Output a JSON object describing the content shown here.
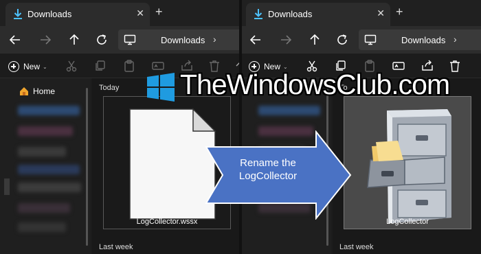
{
  "left_window": {
    "tab_title": "Downloads",
    "tab_close": "✕",
    "new_tab": "+",
    "address": "Downloads",
    "address_chevron": "›",
    "new_label": "New",
    "new_chevron": "⌄",
    "sidebar": {
      "home_label": "Home"
    },
    "group_today": "Today",
    "group_last_week": "Last week",
    "file": {
      "name": "LogCollector.wssx",
      "icon": "blank-document-icon"
    }
  },
  "right_window": {
    "tab_title": "Downloads",
    "tab_close": "✕",
    "new_tab": "+",
    "address": "Downloads",
    "address_chevron": "›",
    "new_label": "New",
    "new_chevron": "⌄",
    "group_today": "To",
    "group_last_week": "Last week",
    "file": {
      "name": "LogCollector",
      "icon": "filing-cabinet-icon",
      "selected": true
    }
  },
  "overlay": {
    "watermark_text": "TheWindowsClub.com",
    "arrow_text_line1": "Rename the",
    "arrow_text_line2": "LogCollector",
    "arrow_color": "#4a72c4"
  },
  "colors": {
    "accent": "#4cc2ff",
    "window_bg": "#1c1c1c",
    "nav_bg": "#2c2c2c",
    "tab_active_bg": "#2c2c2c"
  }
}
